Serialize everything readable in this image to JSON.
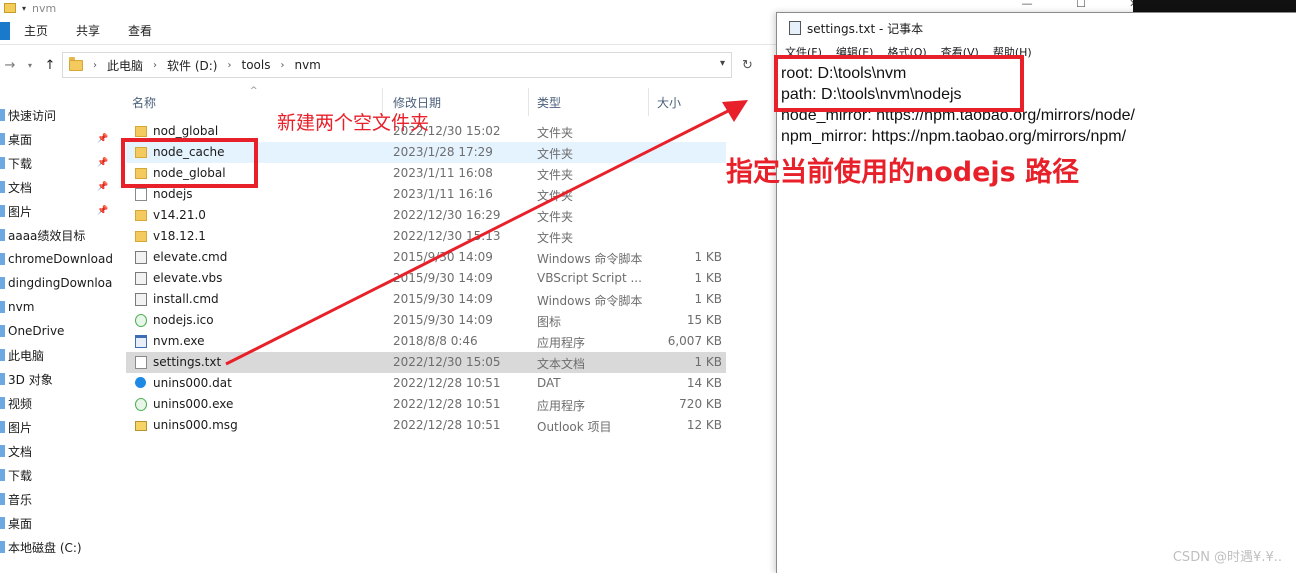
{
  "explorer": {
    "window_title": "nvm",
    "ribbon_tabs": [
      "主页",
      "共享",
      "查看"
    ],
    "breadcrumb": [
      "此电脑",
      "软件 (D:)",
      "tools",
      "nvm"
    ],
    "columns": {
      "name": "名称",
      "date": "修改日期",
      "type": "类型",
      "size": "大小"
    },
    "nav_items": [
      {
        "label": "快速访问",
        "icon": "star-icon",
        "pinned": false
      },
      {
        "label": "桌面",
        "icon": "desktop-icon",
        "pinned": true
      },
      {
        "label": "下载",
        "icon": "download-icon",
        "pinned": true
      },
      {
        "label": "文档",
        "icon": "documents-icon",
        "pinned": true
      },
      {
        "label": "图片",
        "icon": "pictures-icon",
        "pinned": true
      },
      {
        "label": "aaaa绩效目标",
        "icon": "folder-icon",
        "pinned": false
      },
      {
        "label": "chromeDownload",
        "icon": "folder-icon",
        "pinned": false
      },
      {
        "label": "dingdingDownloa",
        "icon": "folder-icon",
        "pinned": false
      },
      {
        "label": "nvm",
        "icon": "folder-icon",
        "pinned": false
      },
      {
        "label": "OneDrive",
        "icon": "cloud-icon",
        "pinned": false
      },
      {
        "label": "此电脑",
        "icon": "computer-icon",
        "pinned": false
      },
      {
        "label": "3D 对象",
        "icon": "cube-icon",
        "pinned": false
      },
      {
        "label": "视频",
        "icon": "video-icon",
        "pinned": false
      },
      {
        "label": "图片",
        "icon": "pictures-icon",
        "pinned": false
      },
      {
        "label": "文档",
        "icon": "documents-icon",
        "pinned": false
      },
      {
        "label": "下载",
        "icon": "download-icon",
        "pinned": false
      },
      {
        "label": "音乐",
        "icon": "music-icon",
        "pinned": false
      },
      {
        "label": "桌面",
        "icon": "desktop-icon",
        "pinned": false
      },
      {
        "label": "本地磁盘 (C:)",
        "icon": "drive-icon",
        "pinned": false
      }
    ],
    "files": [
      {
        "name": "nod_global",
        "date": "2022/12/30 15:02",
        "type": "文件夹",
        "size": "",
        "icon": "folder"
      },
      {
        "name": "node_cache",
        "date": "2023/1/28 17:29",
        "type": "文件夹",
        "size": "",
        "icon": "folder",
        "state": "hover"
      },
      {
        "name": "node_global",
        "date": "2023/1/11 16:08",
        "type": "文件夹",
        "size": "",
        "icon": "folder"
      },
      {
        "name": "nodejs",
        "date": "2023/1/11 16:16",
        "type": "文件夹",
        "size": "",
        "icon": "doc"
      },
      {
        "name": "v14.21.0",
        "date": "2022/12/30 16:29",
        "type": "文件夹",
        "size": "",
        "icon": "folder"
      },
      {
        "name": "v18.12.1",
        "date": "2022/12/30 15:13",
        "type": "文件夹",
        "size": "",
        "icon": "folder"
      },
      {
        "name": "elevate.cmd",
        "date": "2015/9/30 14:09",
        "type": "Windows 命令脚本",
        "size": "1 KB",
        "icon": "cmd"
      },
      {
        "name": "elevate.vbs",
        "date": "2015/9/30 14:09",
        "type": "VBScript Script ...",
        "size": "1 KB",
        "icon": "cmd"
      },
      {
        "name": "install.cmd",
        "date": "2015/9/30 14:09",
        "type": "Windows 命令脚本",
        "size": "1 KB",
        "icon": "cmd"
      },
      {
        "name": "nodejs.ico",
        "date": "2015/9/30 14:09",
        "type": "图标",
        "size": "15 KB",
        "icon": "gear"
      },
      {
        "name": "nvm.exe",
        "date": "2018/8/8 0:46",
        "type": "应用程序",
        "size": "6,007 KB",
        "icon": "exe"
      },
      {
        "name": "settings.txt",
        "date": "2022/12/30 15:05",
        "type": "文本文档",
        "size": "1 KB",
        "icon": "doc",
        "state": "selected"
      },
      {
        "name": "unins000.dat",
        "date": "2022/12/28 10:51",
        "type": "DAT",
        "size": "14 KB",
        "icon": "dat"
      },
      {
        "name": "unins000.exe",
        "date": "2022/12/28 10:51",
        "type": "应用程序",
        "size": "720 KB",
        "icon": "gear"
      },
      {
        "name": "unins000.msg",
        "date": "2022/12/28 10:51",
        "type": "Outlook 项目",
        "size": "12 KB",
        "icon": "msg"
      }
    ]
  },
  "notepad": {
    "title": "settings.txt - 记事本",
    "menu": [
      "文件(F)",
      "编辑(E)",
      "格式(O)",
      "查看(V)",
      "帮助(H)"
    ],
    "lines": [
      "root: D:\\tools\\nvm",
      "path: D:\\tools\\nvm\\nodejs",
      "node_mirror: https://npm.taobao.org/mirrors/node/",
      "npm_mirror: https://npm.taobao.org/mirrors/npm/"
    ]
  },
  "annotations": {
    "folders_note": "新建两个空文件夹",
    "path_note": "指定当前使用的nodejs 路径",
    "color": "#e8202a"
  },
  "watermark": "CSDN @时遇¥.¥.."
}
